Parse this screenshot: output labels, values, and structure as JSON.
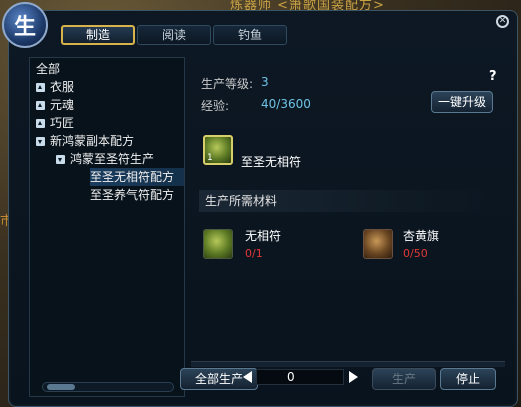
{
  "scene": {
    "title_fragment": "炼器师 <箫歌国装配方>",
    "side_text": "市"
  },
  "window": {
    "emblem_text": "生",
    "close_icon": "close-circle-icon"
  },
  "tabs": [
    {
      "label": "制造",
      "active": true
    },
    {
      "label": "阅读",
      "active": false
    },
    {
      "label": "钓鱼",
      "active": false
    }
  ],
  "tree": {
    "items": [
      {
        "label": "全部"
      },
      {
        "label": "衣服",
        "state": "collapsed"
      },
      {
        "label": "元魂",
        "state": "collapsed"
      },
      {
        "label": "巧匠",
        "state": "collapsed"
      },
      {
        "label": "新鸿蒙副本配方",
        "state": "expanded"
      },
      {
        "label": "鸿蒙至圣符生产",
        "state": "expanded"
      },
      {
        "label": "至圣无相符配方",
        "selected": true
      },
      {
        "label": "至圣养气符配方"
      }
    ]
  },
  "production": {
    "level_label": "生产等级:",
    "level_value": "3",
    "exp_label": "经验:",
    "exp_value": "40/3600",
    "help_text": "?",
    "upgrade_button": "一键升级"
  },
  "product": {
    "name": "至圣无相符",
    "count": "1",
    "icon": "green-talisman-icon"
  },
  "materials": {
    "header": "生产所需材料",
    "items": [
      {
        "name": "无相符",
        "count": "0/1",
        "icon": "green-talisman-icon"
      },
      {
        "name": "杏黄旗",
        "count": "0/50",
        "icon": "brown-flag-icon"
      }
    ]
  },
  "bottom": {
    "produce_all": "全部生产",
    "quantity": "0",
    "produce": "生产",
    "stop": "停止"
  }
}
